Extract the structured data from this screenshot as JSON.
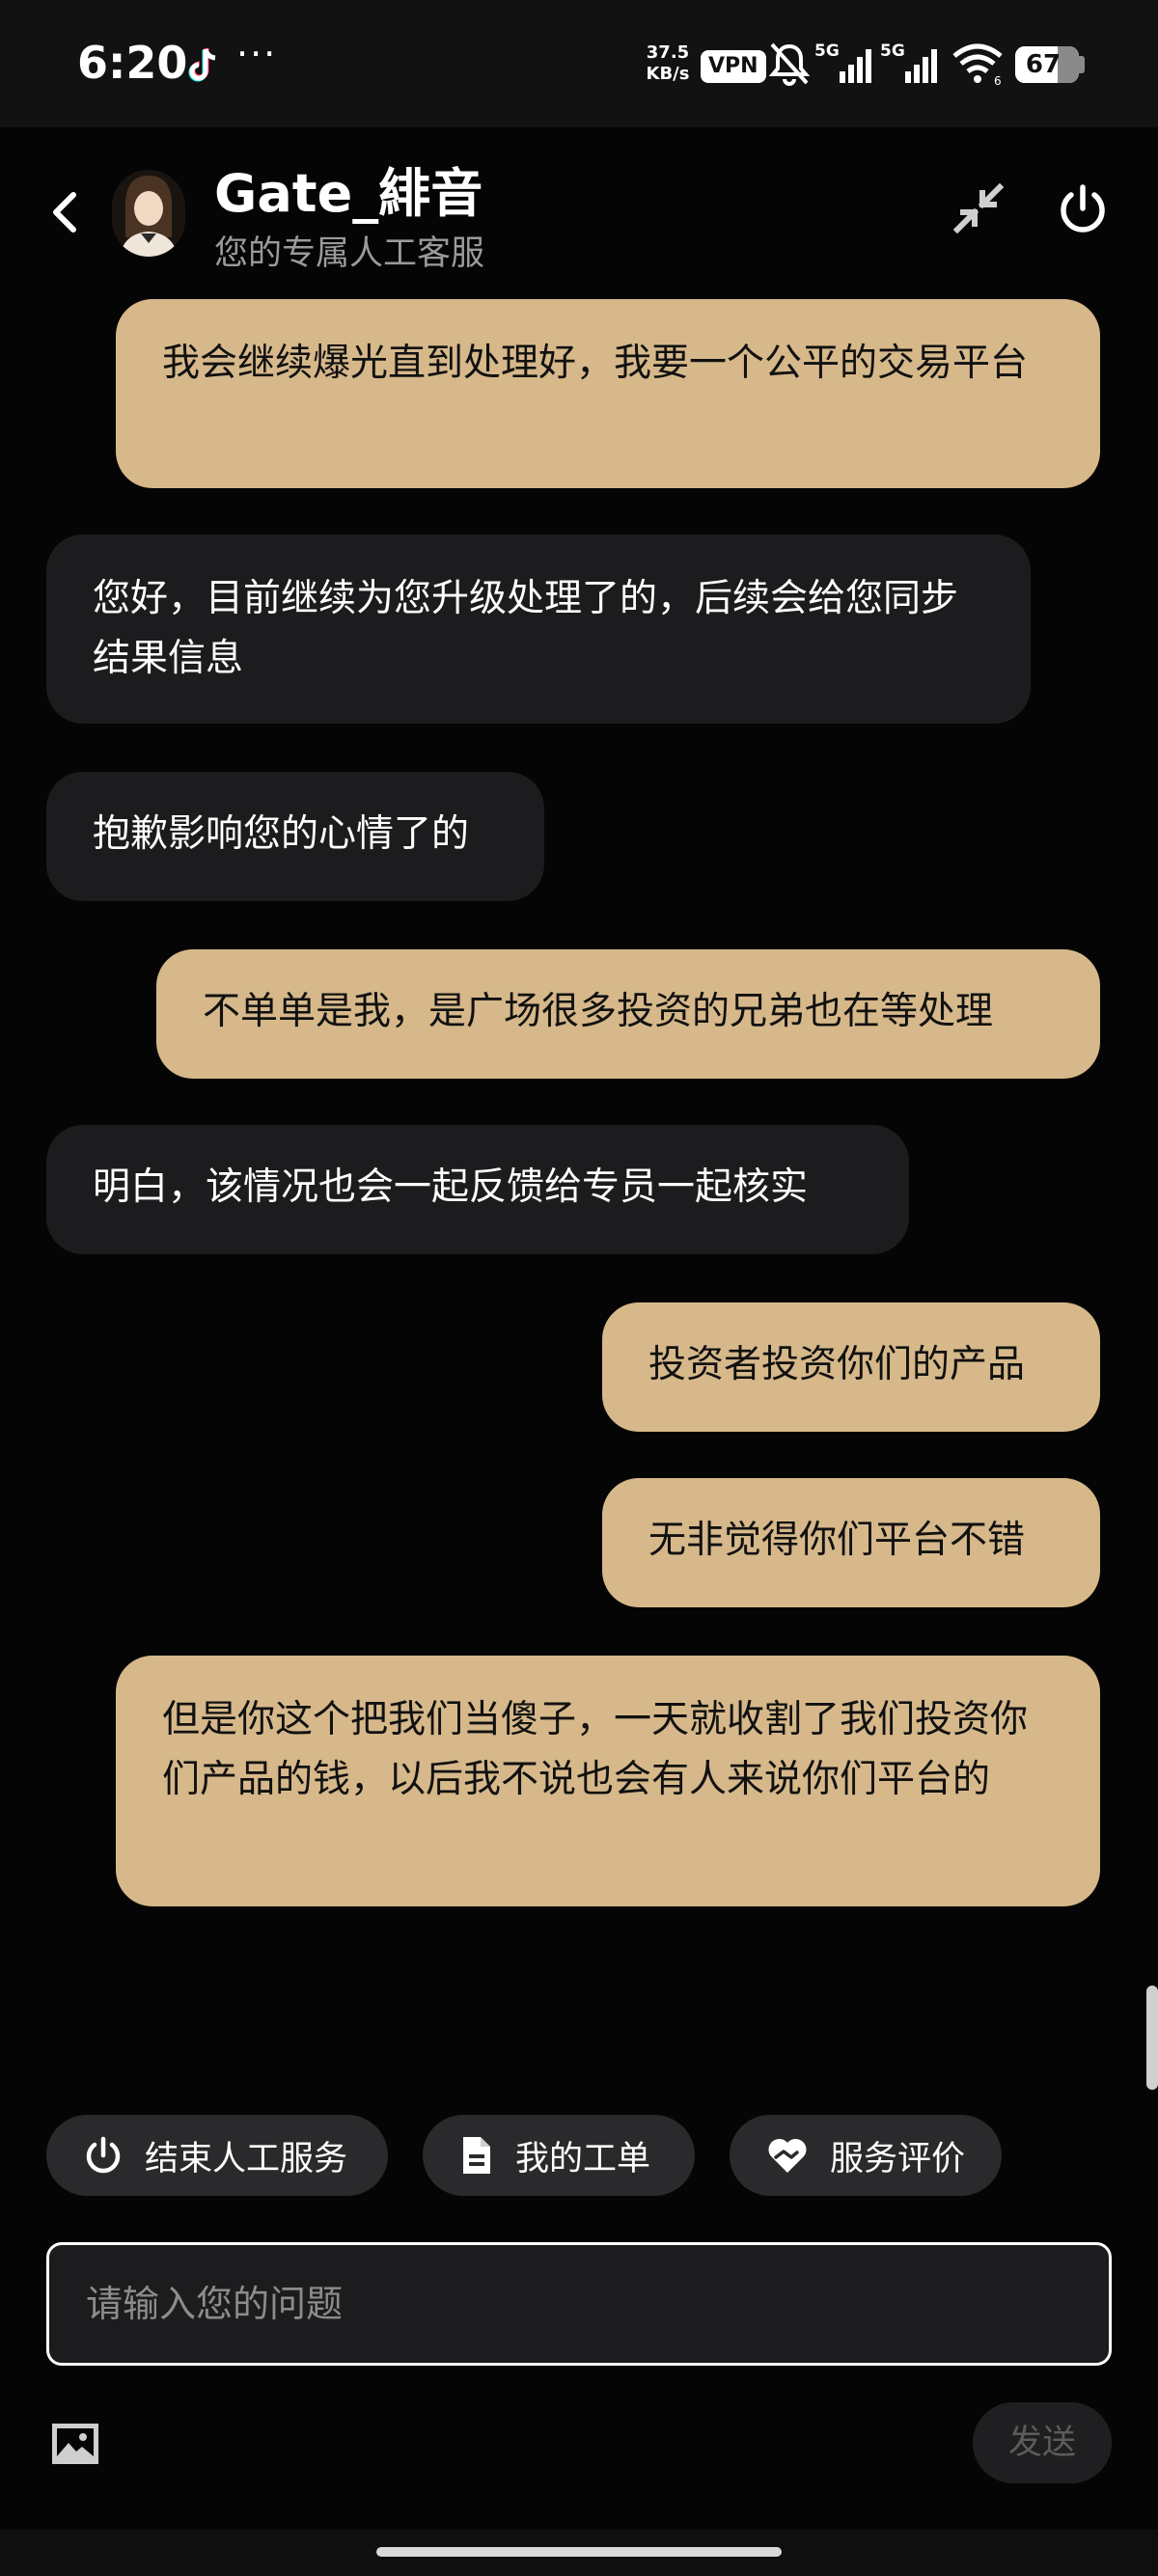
{
  "status_bar": {
    "time": "6:20",
    "net_speed_value": "37.5",
    "net_speed_unit": "KB/s",
    "vpn": "VPN",
    "signal_1": "5G",
    "signal_2": "5G",
    "battery": "67"
  },
  "header": {
    "title": "Gate_緋音",
    "subtitle": "您的专属人工客服"
  },
  "messages": [
    {
      "sender": "user",
      "text": "我会继续爆光直到处理好，我要一个公平的交易平台"
    },
    {
      "sender": "agent",
      "text": "您好，目前继续为您升级处理了的，后续会给您同步结果信息"
    },
    {
      "sender": "agent",
      "text": "抱歉影响您的心情了的"
    },
    {
      "sender": "user",
      "text": "不单单是我，是广场很多投资的兄弟也在等处理"
    },
    {
      "sender": "agent",
      "text": "明白，该情况也会一起反馈给专员一起核实"
    },
    {
      "sender": "user",
      "text": "投资者投资你们的产品"
    },
    {
      "sender": "user",
      "text": "无非觉得你们平台不错"
    },
    {
      "sender": "user",
      "text": "但是你这个把我们当傻子，一天就收割了我们投资你们产品的钱，以后我不说也会有人来说你们平台的"
    }
  ],
  "quick_actions": [
    {
      "label": "结束人工服务",
      "icon": "power-icon"
    },
    {
      "label": "我的工单",
      "icon": "document-icon"
    },
    {
      "label": "服务评价",
      "icon": "heart-handshake-icon"
    }
  ],
  "composer": {
    "placeholder": "请输入您的问题",
    "value": "",
    "send_label": "发送"
  },
  "colors": {
    "background": "#050505",
    "user_bubble": "#d6b88a",
    "agent_bubble": "#1c1c1e"
  }
}
